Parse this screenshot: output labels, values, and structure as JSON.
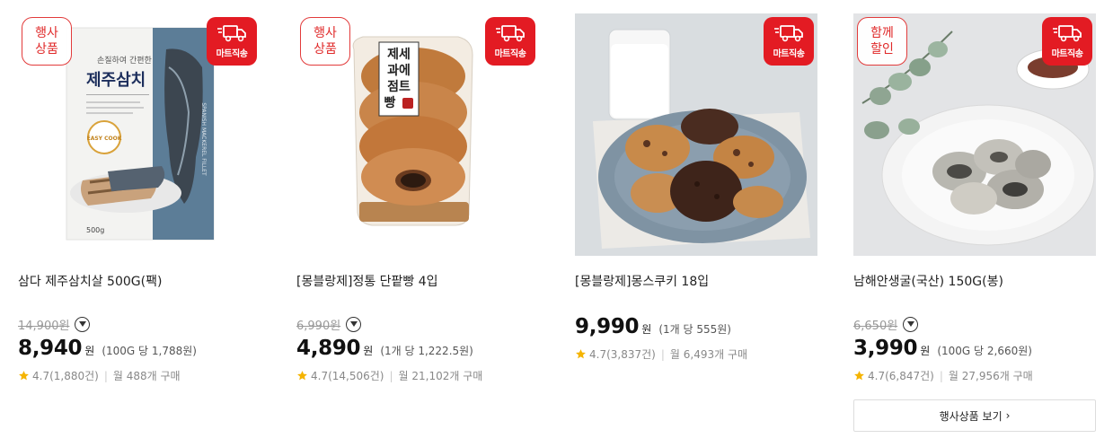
{
  "colors": {
    "accent": "#e31b23",
    "promo_border": "#e23b3b",
    "star": "#f5b400",
    "muted": "#999999"
  },
  "products": [
    {
      "promo_tag": [
        "행사",
        "상품"
      ],
      "delivery_label": "마트직송",
      "name": "삼다 제주삼치살 500G(팩)",
      "original_price": "14,900원",
      "price": "8,940",
      "currency": "원",
      "unit_price": "(100G 당 1,788원)",
      "rating": "4.7(1,880건)",
      "monthly": "월 488개 구매",
      "package": {
        "script": "손질하여 간편한",
        "title": "제주삼치",
        "badge": "EASY COOK",
        "weight": "500g",
        "side": "SPANISH MACKEREL FILLET"
      }
    },
    {
      "promo_tag": [
        "행사",
        "상품"
      ],
      "delivery_label": "마트직송",
      "name": "[몽블랑제]정통 단팥빵 4입",
      "original_price": "6,990원",
      "price": "4,890",
      "currency": "원",
      "unit_price": "(1개 당 1,222.5원)",
      "rating": "4.7(14,506건)",
      "monthly": "월 21,102개 구매",
      "package": {
        "label_lines": [
          "제세",
          "과에",
          "점트",
          "빵"
        ]
      }
    },
    {
      "promo_tag": null,
      "delivery_label": "마트직송",
      "name": "[몽블랑제]몽스쿠키 18입",
      "original_price": null,
      "price": "9,990",
      "currency": "원",
      "unit_price": "(1개 당 555원)",
      "rating": "4.7(3,837건)",
      "monthly": "월 6,493개 구매"
    },
    {
      "promo_tag": [
        "함께",
        "할인"
      ],
      "delivery_label": "마트직송",
      "name": "남해안생굴(국산) 150G(봉)",
      "original_price": "6,650원",
      "price": "3,990",
      "currency": "원",
      "unit_price": "(100G 당 2,660원)",
      "rating": "4.7(6,847건)",
      "monthly": "월 27,956개 구매"
    }
  ],
  "more_button": {
    "label": "행사상품 보기",
    "arrow": "›"
  }
}
